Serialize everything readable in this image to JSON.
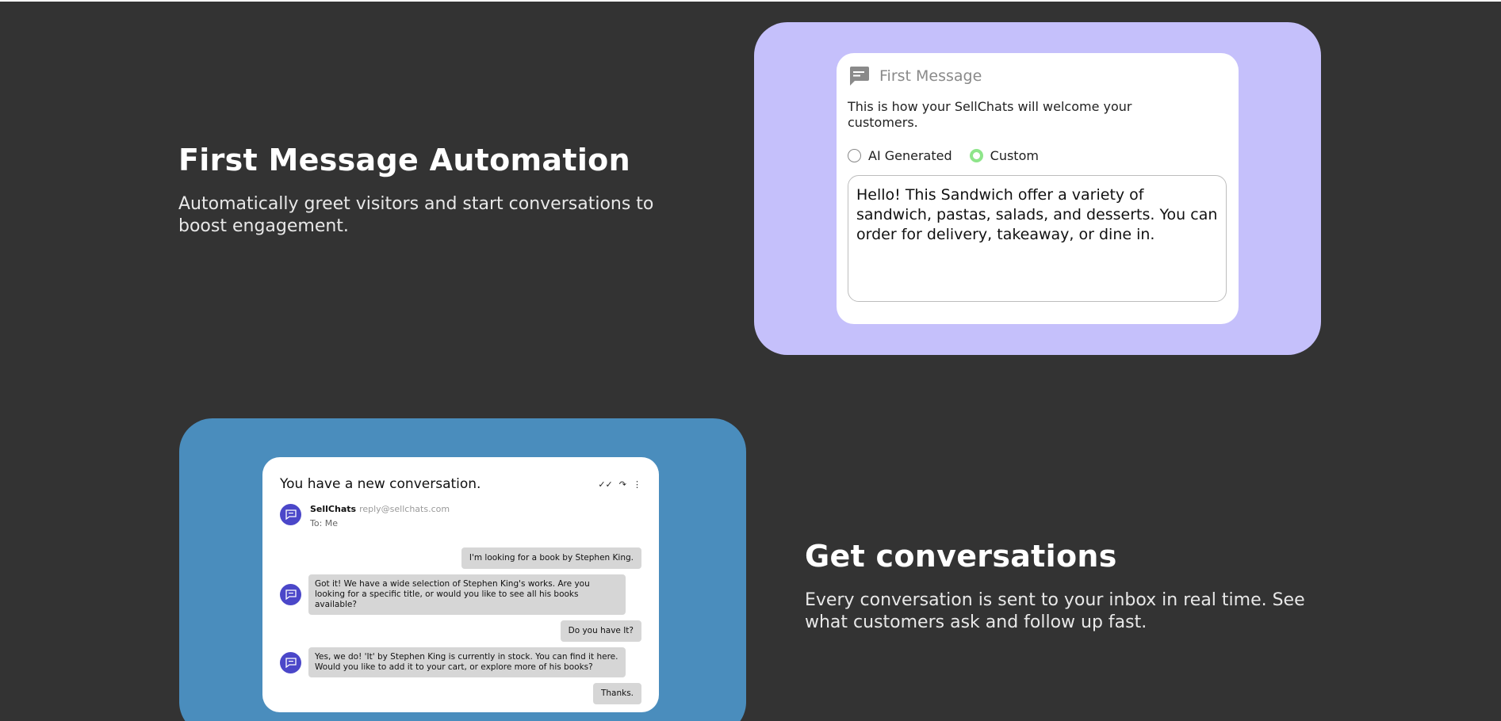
{
  "sections": [
    {
      "title": "First Message Automation",
      "description": "Automatically greet visitors and start conversations to boost engagement."
    },
    {
      "title": "Get conversations",
      "description": "Every conversation is sent to your inbox in real time. See what customers ask and follow up fast."
    }
  ],
  "first_message_card": {
    "title": "First Message",
    "icon": "chat-message-icon",
    "description": "This is how your SellChats will welcome your customers.",
    "options": [
      {
        "label": "AI Generated",
        "selected": false
      },
      {
        "label": "Custom",
        "selected": true
      }
    ],
    "message": "Hello! This Sandwich offer a variety of sandwich, pastas, salads, and desserts. You can order for delivery, takeaway, or dine in."
  },
  "conversation_card": {
    "title": "You have a new conversation.",
    "actions": [
      "✓✓",
      "↷",
      "⋮"
    ],
    "sender_name": "SellChats",
    "sender_email": "reply@sellchats.com",
    "recipient": "To: Me",
    "messages": [
      {
        "from": "customer",
        "text": "I'm looking for a book by Stephen King."
      },
      {
        "from": "bot",
        "text": "Got it! We have a wide selection of Stephen King's works. Are you looking for a specific title, or would you like to see all his books available?"
      },
      {
        "from": "customer",
        "text": "Do you have It?"
      },
      {
        "from": "bot",
        "text": "Yes, we do! 'It' by Stephen King is currently in stock. You can find it here. Would you like to add it to your cart, or explore more of his books?"
      },
      {
        "from": "customer",
        "text": "Thanks."
      }
    ]
  },
  "colors": {
    "background": "#333333",
    "panel_purple": "#c5c0fb",
    "panel_blue": "#4a8dbd",
    "radio_selected": "#8ee58a",
    "avatar": "#4b47c9",
    "bubble": "#d6d6d6"
  }
}
